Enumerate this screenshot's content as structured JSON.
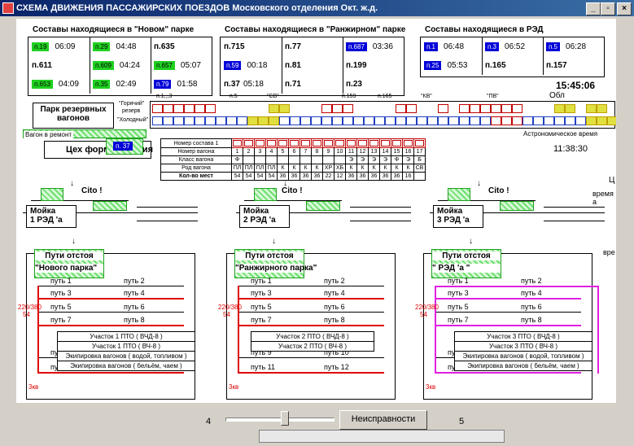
{
  "window": {
    "title": "СХЕМА ДВИЖЕНИЯ ПАССАЖИРСКИХ ПОЕЗДОВ Московского отделения Окт. ж.д.",
    "btn_min": "_",
    "btn_max": "▫",
    "btn_close": "×"
  },
  "parks": [
    {
      "header": "Составы находящиеся  в \"Новом\" парке",
      "rows": [
        [
          {
            "tag": "п.19",
            "color": "g",
            "time": "06:09"
          },
          {
            "tag": "п.29",
            "color": "g",
            "time": "04:48"
          },
          {
            "text": "п.635"
          }
        ],
        [
          {
            "text": "п.611"
          },
          {
            "tag": "п.609",
            "color": "g",
            "time": "04:24"
          },
          {
            "tag": "п.657",
            "color": "g",
            "time": "05:07"
          }
        ],
        [
          {
            "tag": "п.653",
            "color": "g",
            "time": "04:09"
          },
          {
            "tag": "п.35",
            "color": "g",
            "time": "02:49"
          },
          {
            "tag": "п.79",
            "color": "b",
            "time": "01:58"
          }
        ]
      ]
    },
    {
      "header": "Составы находящиеся  в \"Ранжирном\" парке",
      "rows": [
        [
          {
            "text": "п.715"
          },
          {
            "text": "п.77"
          },
          {
            "tag": "п.687",
            "color": "b",
            "time": "03:36"
          }
        ],
        [
          {
            "tag": "п.59",
            "color": "b",
            "time": "00:18"
          },
          {
            "text": "п.81"
          },
          {
            "text": "п.199"
          }
        ],
        [
          {
            "text": "п.37",
            "time": "05:18"
          },
          {
            "text": "п.71"
          },
          {
            "text": "п.23"
          }
        ]
      ]
    },
    {
      "header": "Составы находящиеся  в  РЭД",
      "rows": [
        [
          {
            "tag": "п.1",
            "color": "b",
            "time": "06:48"
          },
          {
            "tag": "п.3",
            "color": "b",
            "time": "06:52"
          },
          {
            "tag": "п.5",
            "color": "b",
            "time": "06:28"
          }
        ],
        [
          {
            "tag": "п.25",
            "color": "b",
            "time": "05:53"
          },
          {
            "text": "п.165"
          },
          {
            "text": "п.157"
          }
        ]
      ]
    }
  ],
  "clock": "15:45:06",
  "obl": "Обл",
  "reserve": {
    "title1": "Парк резервных",
    "title2": "вагонов",
    "warm": "\"Горячий\"",
    "warm2": "резерв",
    "cold": "\"Холодный\"",
    "marks": [
      "п.1,,,3",
      "п.5",
      "\"СВ\"",
      "п.159",
      "п.165",
      "\"КВ\"",
      "\"ПВ\""
    ]
  },
  "repair": "Вагон в ремонт",
  "formation": {
    "label": "Цех формирования",
    "train": "п. 37"
  },
  "astro": {
    "label": "Астрономическое время",
    "time": "11:38:30"
  },
  "spec": {
    "row_labels": [
      "Номер состава  1",
      "Номер вагона",
      "Класс вагона",
      "Род вагона",
      "Кол-во мест"
    ],
    "numbers": [
      "1",
      "2",
      "3",
      "4",
      "5",
      "6",
      "7",
      "8",
      "9",
      "10",
      "11",
      "12",
      "13",
      "14",
      "15",
      "16",
      "17"
    ],
    "classes": [
      "Ф",
      "",
      "",
      "",
      "",
      "",
      "",
      "",
      "",
      "",
      "Э",
      "Э",
      "Э",
      "Э",
      "Ф",
      "Э",
      "Б"
    ],
    "kinds": [
      "ПЛ",
      "ПЛ",
      "ПЛ",
      "ПЛ",
      "К",
      "К",
      "К",
      "К",
      "ХР",
      "ХБ",
      "К",
      "К",
      "К",
      "К",
      "К",
      "К",
      "СВ"
    ],
    "seats": [
      "54",
      "54",
      "54",
      "54",
      "36",
      "36",
      "36",
      "36",
      "22",
      "12",
      "36",
      "36",
      "36",
      "36",
      "36",
      "16",
      ""
    ]
  },
  "wash": [
    {
      "name": "Мойка",
      "num": "1 РЭД 'а",
      "cito": "Cito !"
    },
    {
      "name": "Мойка",
      "num": "2 РЭД 'а",
      "cito": "Cito !"
    },
    {
      "name": "Мойка",
      "num": "3 РЭД 'а",
      "cito": "Cito !"
    }
  ],
  "side": {
    "time": "время а",
    "vre": "вре",
    "c": "Ц"
  },
  "yards": [
    {
      "title": "Пути отстоя",
      "sub": "\"Нового парка\"",
      "sections": [
        "Участок 1   ПТО   ( ВЧД-8 )",
        "Участок 1   ПТО   ( ВЧ-8 )",
        "Экипировка вагонов ( водой, топливом )",
        "Экипировка вагонов ( бельём, чаем )"
      ]
    },
    {
      "title": "Пути отстоя",
      "sub": "\"Ранжирного парка\"",
      "sections": [
        "Участок 2   ПТО   ( ВЧД-8 )",
        "Участок 2   ПТО   ( ВЧ-8 )"
      ]
    },
    {
      "title": "Пути отстоя",
      "sub": "\" РЭД 'а \"",
      "sections": [
        "Участок 3   ПТО   ( ВЧД-8 )",
        "Участок 3   ПТО   ( ВЧ-8 )",
        "Экипировка вагонов ( водой, топливом )",
        "Экипировка вагонов ( бельём, чаем )"
      ]
    }
  ],
  "tracks": [
    "путь 1",
    "путь 2",
    "путь 3",
    "путь 4",
    "путь 5",
    "путь 6",
    "путь 7",
    "путь 8",
    "путь 9",
    "путь 10",
    "путь 11",
    "путь 12"
  ],
  "voltage": {
    "a": "220/380",
    "b": "54",
    "zkv": "3кв"
  },
  "bottom": {
    "left_num": "4",
    "right_num": "5",
    "button": "Неисправности"
  },
  "colors": {
    "green": "#20d020",
    "blue": "#0000d8",
    "red": "#e00000",
    "magenta": "#e020e0"
  }
}
